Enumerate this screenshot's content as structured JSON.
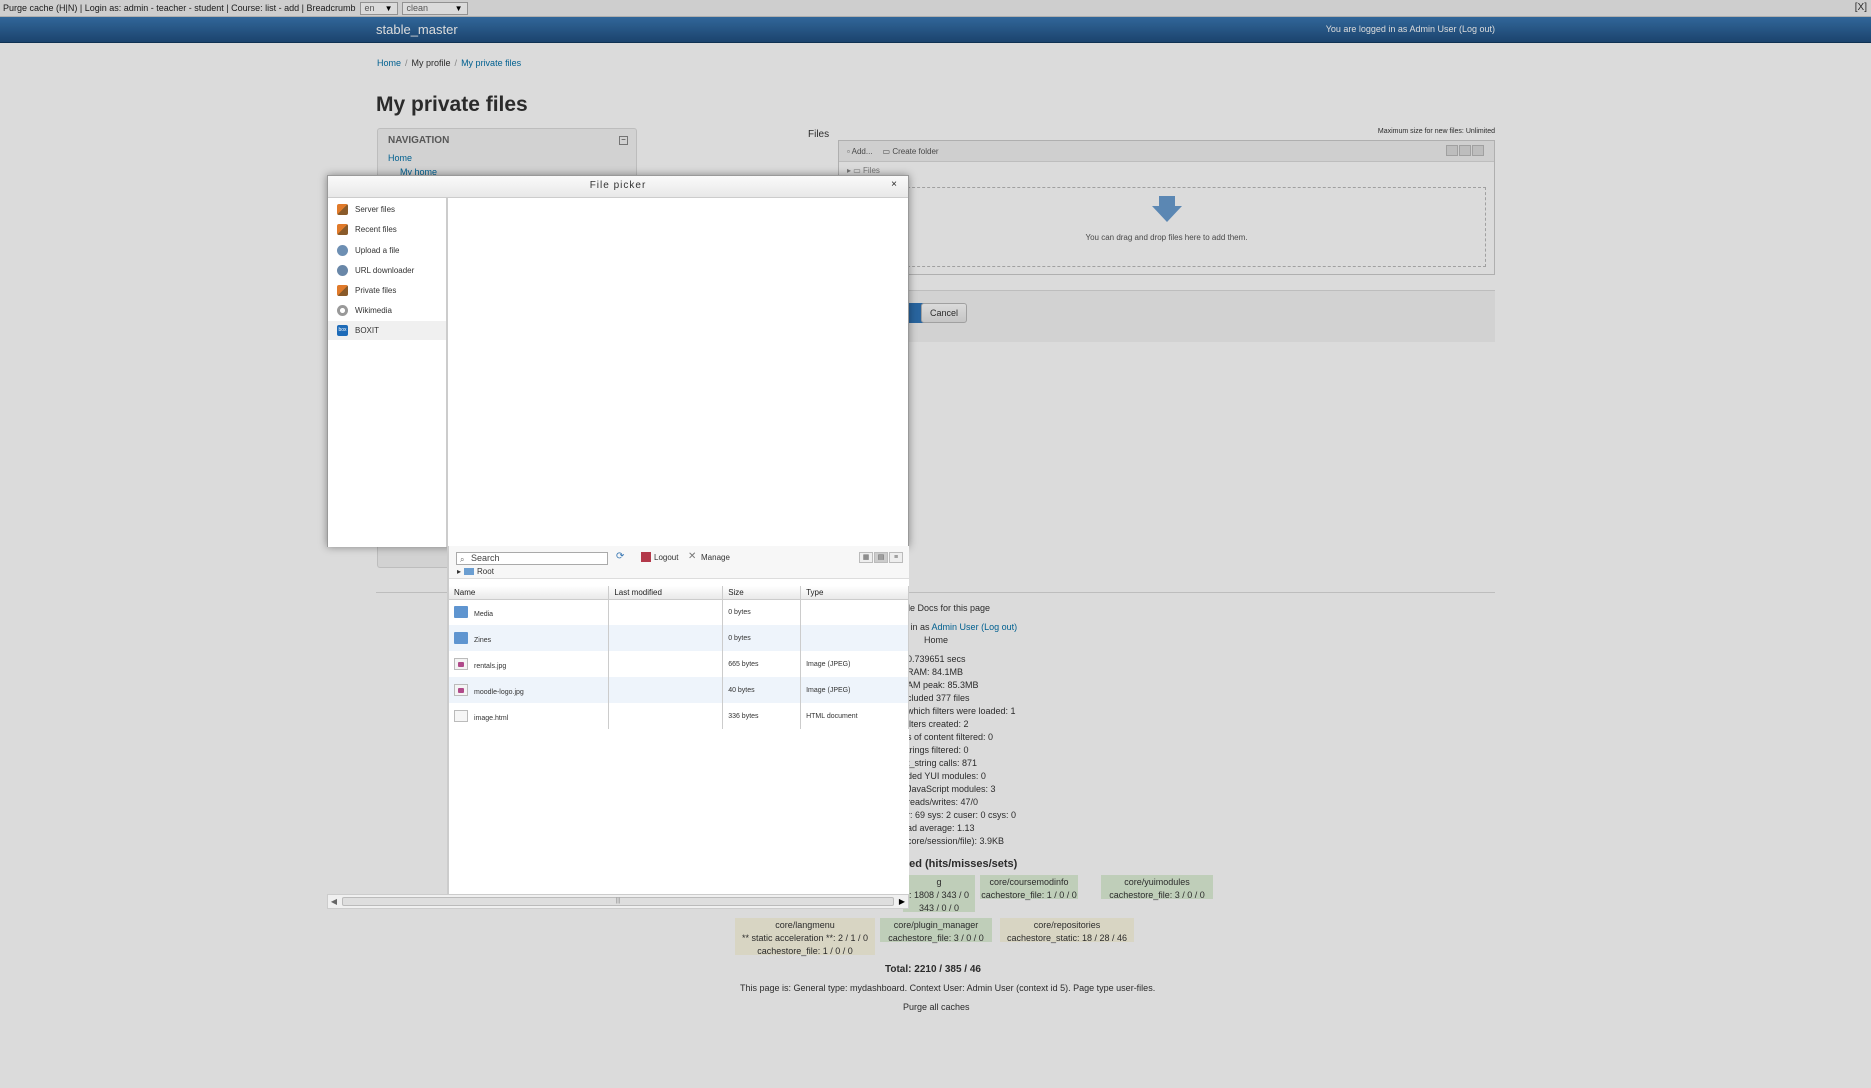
{
  "devbar": {
    "text": "Purge cache (H|N) | Login as: admin - teacher - student | Course: list - add | Breadcrumb",
    "lang_select": "en",
    "theme_select": "clean",
    "close": "[X]"
  },
  "header": {
    "brand": "stable_master",
    "login_prefix": "You are logged in as",
    "user": "Admin User",
    "logout": "(Log out)"
  },
  "breadcrumb": {
    "items": [
      "Home",
      "My profile",
      "My private files"
    ],
    "sep": "/"
  },
  "page_title": "My private files",
  "navigation": {
    "title": "NAVIGATION",
    "home": "Home",
    "my_home": "My home"
  },
  "filemanager": {
    "label": "Files",
    "max_size": "Maximum size for new files: Unlimited",
    "add": "Add...",
    "create_folder": "Create folder",
    "path": "Files",
    "drop_message": "You can drag and drop files here to add them."
  },
  "buttons": {
    "cancel": "Cancel"
  },
  "footer": {
    "docs": "dle Docs for this page",
    "logged_prefix": "d in as",
    "logged_user": "Admin User",
    "logged_logout": "(Log out)",
    "home": "Home",
    "perf": [
      "0.739651 secs",
      "RAM: 84.1MB",
      "AM peak: 85.3MB",
      "cluded 377 files",
      "which filters were loaded: 1",
      "ilters created: 2",
      "s of content filtered: 0",
      "trings filtered: 0",
      "t_string calls: 871",
      "ded YUI modules: 0",
      "JavaScript modules: 3",
      "reads/writes: 47/0",
      "r: 69 sys: 2 cuser: 0 csys: 0",
      "ad average: 1.13",
      "core/session/file): 3.9KB"
    ],
    "caches_title": "sed (hits/misses/sets)",
    "cache_boxes": [
      {
        "title": "g",
        "lines": [
          ": 1808 / 343 / 0",
          "343 / 0 / 0"
        ]
      },
      {
        "title": "core/coursemodinfo",
        "lines": [
          "cachestore_file: 1 / 0 / 0"
        ]
      },
      {
        "title": "core/yuimodules",
        "lines": [
          "cachestore_file: 3 / 0 / 0"
        ]
      },
      {
        "title": "core/langmenu",
        "lines": [
          "** static acceleration **: 2 / 1 / 0",
          "cachestore_file: 1 / 0 / 0"
        ]
      },
      {
        "title": "core/plugin_manager",
        "lines": [
          "cachestore_file: 3 / 0 / 0"
        ]
      },
      {
        "title": "core/repositories",
        "lines": [
          "cachestore_static: 18 / 28 / 46"
        ]
      }
    ],
    "total": "Total: 2210 / 385 / 46",
    "page_info": "This page is: General type: mydashboard. Context User: Admin User (context id 5). Page type user-files.",
    "purge": "Purge all caches"
  },
  "filepicker": {
    "title": "File picker",
    "close": "×",
    "repositories": [
      {
        "label": "Server files",
        "icon": "server-icon"
      },
      {
        "label": "Recent files",
        "icon": "recent-icon"
      },
      {
        "label": "Upload a file",
        "icon": "upload-icon"
      },
      {
        "label": "URL downloader",
        "icon": "url-icon"
      },
      {
        "label": "Private files",
        "icon": "private-icon"
      },
      {
        "label": "Wikimedia",
        "icon": "wikimedia-icon"
      },
      {
        "label": "BOXIT",
        "icon": "box-icon"
      }
    ],
    "search_placeholder": "Search",
    "logout": "Logout",
    "manage": "Manage",
    "root": "Root",
    "columns": [
      "Name",
      "Last modified",
      "Size",
      "Type"
    ],
    "files": [
      {
        "name": "Media",
        "modified": "",
        "size": "0 bytes",
        "type": "",
        "kind": "folder"
      },
      {
        "name": "Zines",
        "modified": "",
        "size": "0 bytes",
        "type": "",
        "kind": "folder"
      },
      {
        "name": "rentals.jpg",
        "modified": "",
        "size": "665 bytes",
        "type": "Image (JPEG)",
        "kind": "img"
      },
      {
        "name": "moodle-logo.jpg",
        "modified": "",
        "size": "40 bytes",
        "type": "Image (JPEG)",
        "kind": "img"
      },
      {
        "name": "image.html",
        "modified": "",
        "size": "336 bytes",
        "type": "HTML document",
        "kind": "doc"
      }
    ],
    "scroll_thumb": "|||"
  }
}
